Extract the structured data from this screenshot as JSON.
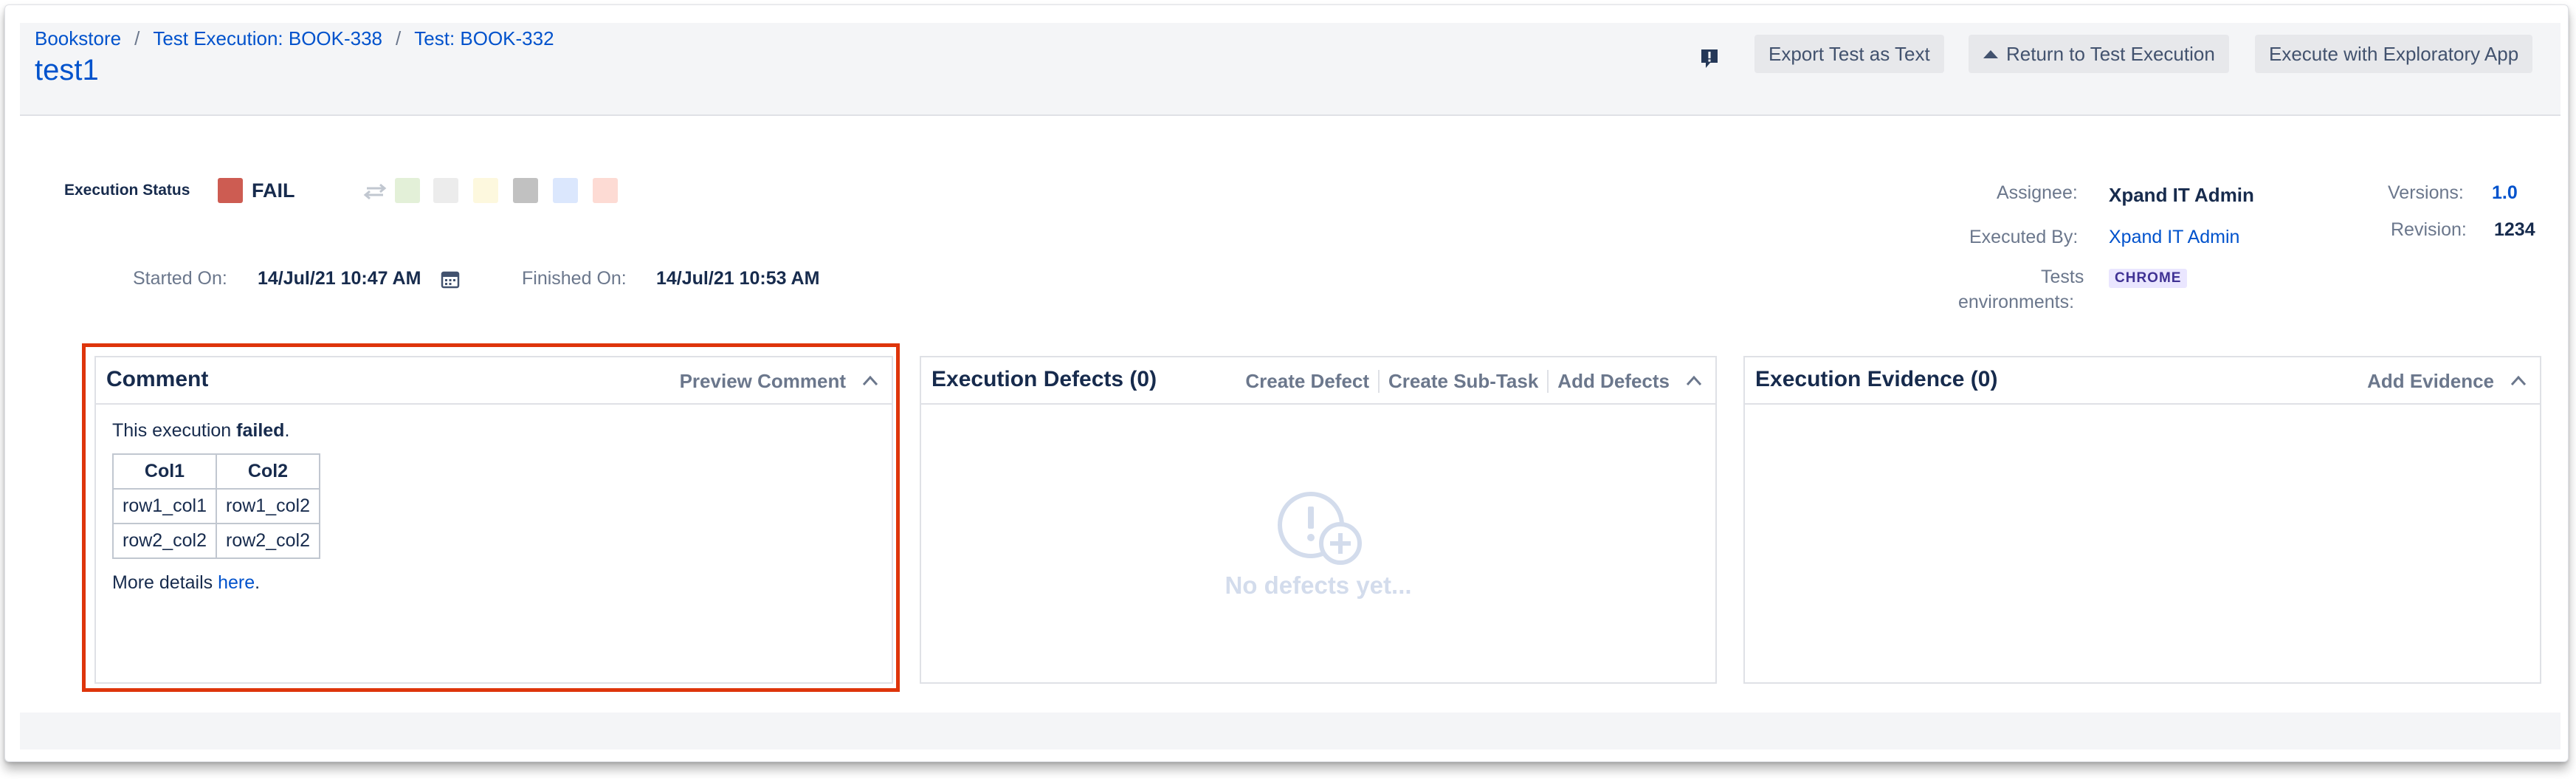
{
  "breadcrumb": {
    "project": "Bookstore",
    "separator": "/",
    "test_execution": "Test Execution: BOOK-338",
    "test": "Test: BOOK-332"
  },
  "page_title": "test1",
  "header_buttons": {
    "feedback_icon": "feedback-icon",
    "export": "Export Test as Text",
    "return": "Return to Test Execution",
    "exploratory": "Execute with Exploratory App"
  },
  "execution_status": {
    "label": "Execution Status",
    "value": "FAIL",
    "colors": {
      "fail": "#cd5c52",
      "pass": "#e3f0d8",
      "todo": "#ececec",
      "executing": "#fdf8de",
      "aborted": "#c1c1c1",
      "blocked": "#dbe7fd",
      "other": "#fddbd4"
    }
  },
  "dates": {
    "started_label": "Started On:",
    "started_value": "14/Jul/21 10:47 AM",
    "finished_label": "Finished On:",
    "finished_value": "14/Jul/21 10:53 AM"
  },
  "details": {
    "assignee_label": "Assignee:",
    "assignee_value": "Xpand IT Admin",
    "executed_by_label": "Executed By:",
    "executed_by_value": "Xpand IT Admin",
    "environments_label_1": "Tests",
    "environments_label_2": "environments:",
    "environment_badge": "CHROME",
    "versions_label": "Versions:",
    "versions_value": "1.0",
    "revision_label": "Revision:",
    "revision_value": "1234"
  },
  "comment_panel": {
    "title": "Comment",
    "preview_action": "Preview Comment",
    "text_before": "This execution ",
    "text_bold": "failed",
    "text_after": ".",
    "table": {
      "headers": [
        "Col1",
        "Col2"
      ],
      "rows": [
        [
          "row1_col1",
          "row1_col2"
        ],
        [
          "row2_col2",
          "row2_col2"
        ]
      ]
    },
    "more_before": "More details ",
    "more_link": "here",
    "more_after": "."
  },
  "defects_panel": {
    "title": "Execution Defects (0)",
    "create_defect": "Create Defect",
    "create_subtask": "Create Sub-Task",
    "add_defects": "Add Defects",
    "empty_text": "No defects yet..."
  },
  "evidence_panel": {
    "title": "Execution Evidence (0)",
    "add_evidence": "Add Evidence"
  }
}
